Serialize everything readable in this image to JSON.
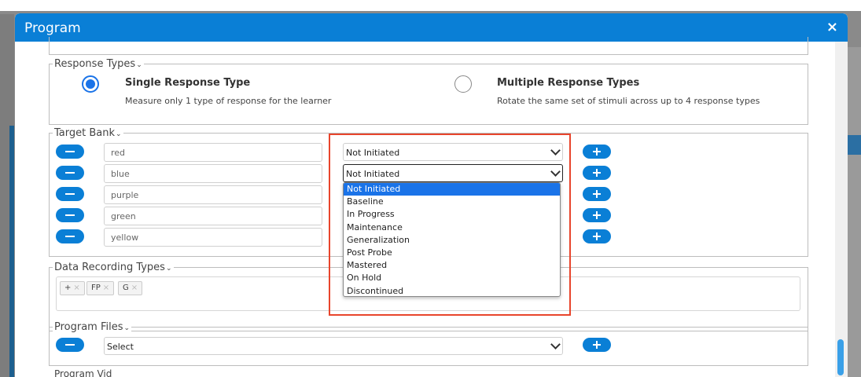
{
  "modal": {
    "title": "Program",
    "close_icon": "×"
  },
  "response_types": {
    "legend": "Response Types",
    "options": [
      {
        "title": "Single Response Type",
        "desc": "Measure only 1 type of response for the learner",
        "checked": true
      },
      {
        "title": "Multiple Response Types",
        "desc": "Rotate the same set of stimuli across up to 4 response types",
        "checked": false
      }
    ]
  },
  "target_bank": {
    "legend": "Target Bank",
    "targets": [
      "red",
      "blue",
      "purple",
      "green",
      "yellow"
    ],
    "status_values": [
      "Not Initiated",
      "Not Initiated"
    ],
    "dropdown_options": [
      "Not Initiated",
      "Baseline",
      "In Progress",
      "Maintenance",
      "Generalization",
      "Post Probe",
      "Mastered",
      "On Hold",
      "Discontinued"
    ],
    "dropdown_selected": "Not Initiated"
  },
  "data_recording": {
    "legend": "Data Recording Types",
    "tags": [
      "+",
      "FP",
      "G"
    ]
  },
  "program_files": {
    "legend": "Program Files",
    "select_value": "Select"
  },
  "program_videos_label_partial": "Program Vid",
  "colors": {
    "accent": "#0a7fd6",
    "highlight": "#e8452c",
    "selected": "#1a73e8"
  },
  "icons": {
    "chevron": "chevron-down-icon",
    "minus": "minus-icon",
    "plus": "plus-icon"
  }
}
